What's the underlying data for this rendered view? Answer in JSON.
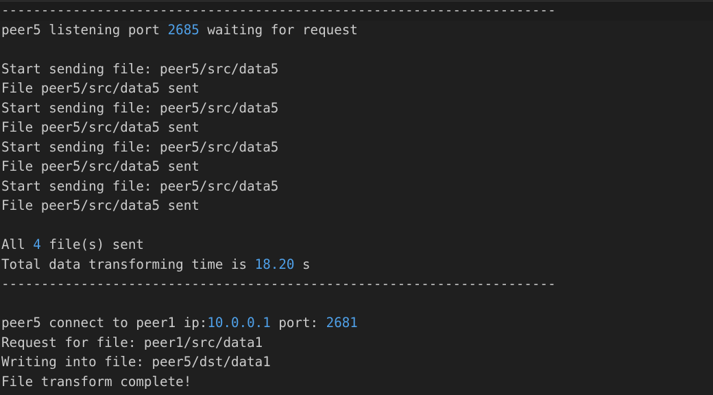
{
  "colors": {
    "background": "#1f1f1f",
    "text": "#cccccc",
    "number_highlight": "#4fa0e8"
  },
  "terminal": {
    "separator": "----------------------------------------------------------------------",
    "listen": {
      "prefix": "peer5 listening port ",
      "port": "2685",
      "suffix": " waiting for request"
    },
    "send_log": [
      "Start sending file: peer5/src/data5",
      "File peer5/src/data5 sent",
      "Start sending file: peer5/src/data5",
      "File peer5/src/data5 sent",
      "Start sending file: peer5/src/data5",
      "File peer5/src/data5 sent",
      "Start sending file: peer5/src/data5",
      "File peer5/src/data5 sent"
    ],
    "summary": {
      "all_prefix": "All ",
      "count": "4",
      "all_suffix": " file(s) sent",
      "time_prefix": "Total data transforming time is ",
      "time_value": "18.20",
      "time_suffix": " s"
    },
    "connect": {
      "prefix": "peer5 connect to peer1 ip:",
      "ip": "10.0.0.1",
      "middle": " port: ",
      "port": "2681"
    },
    "request": "Request for file: peer1/src/data1",
    "writing": "Writing into file: peer5/dst/data1",
    "complete": "File transform complete!"
  }
}
